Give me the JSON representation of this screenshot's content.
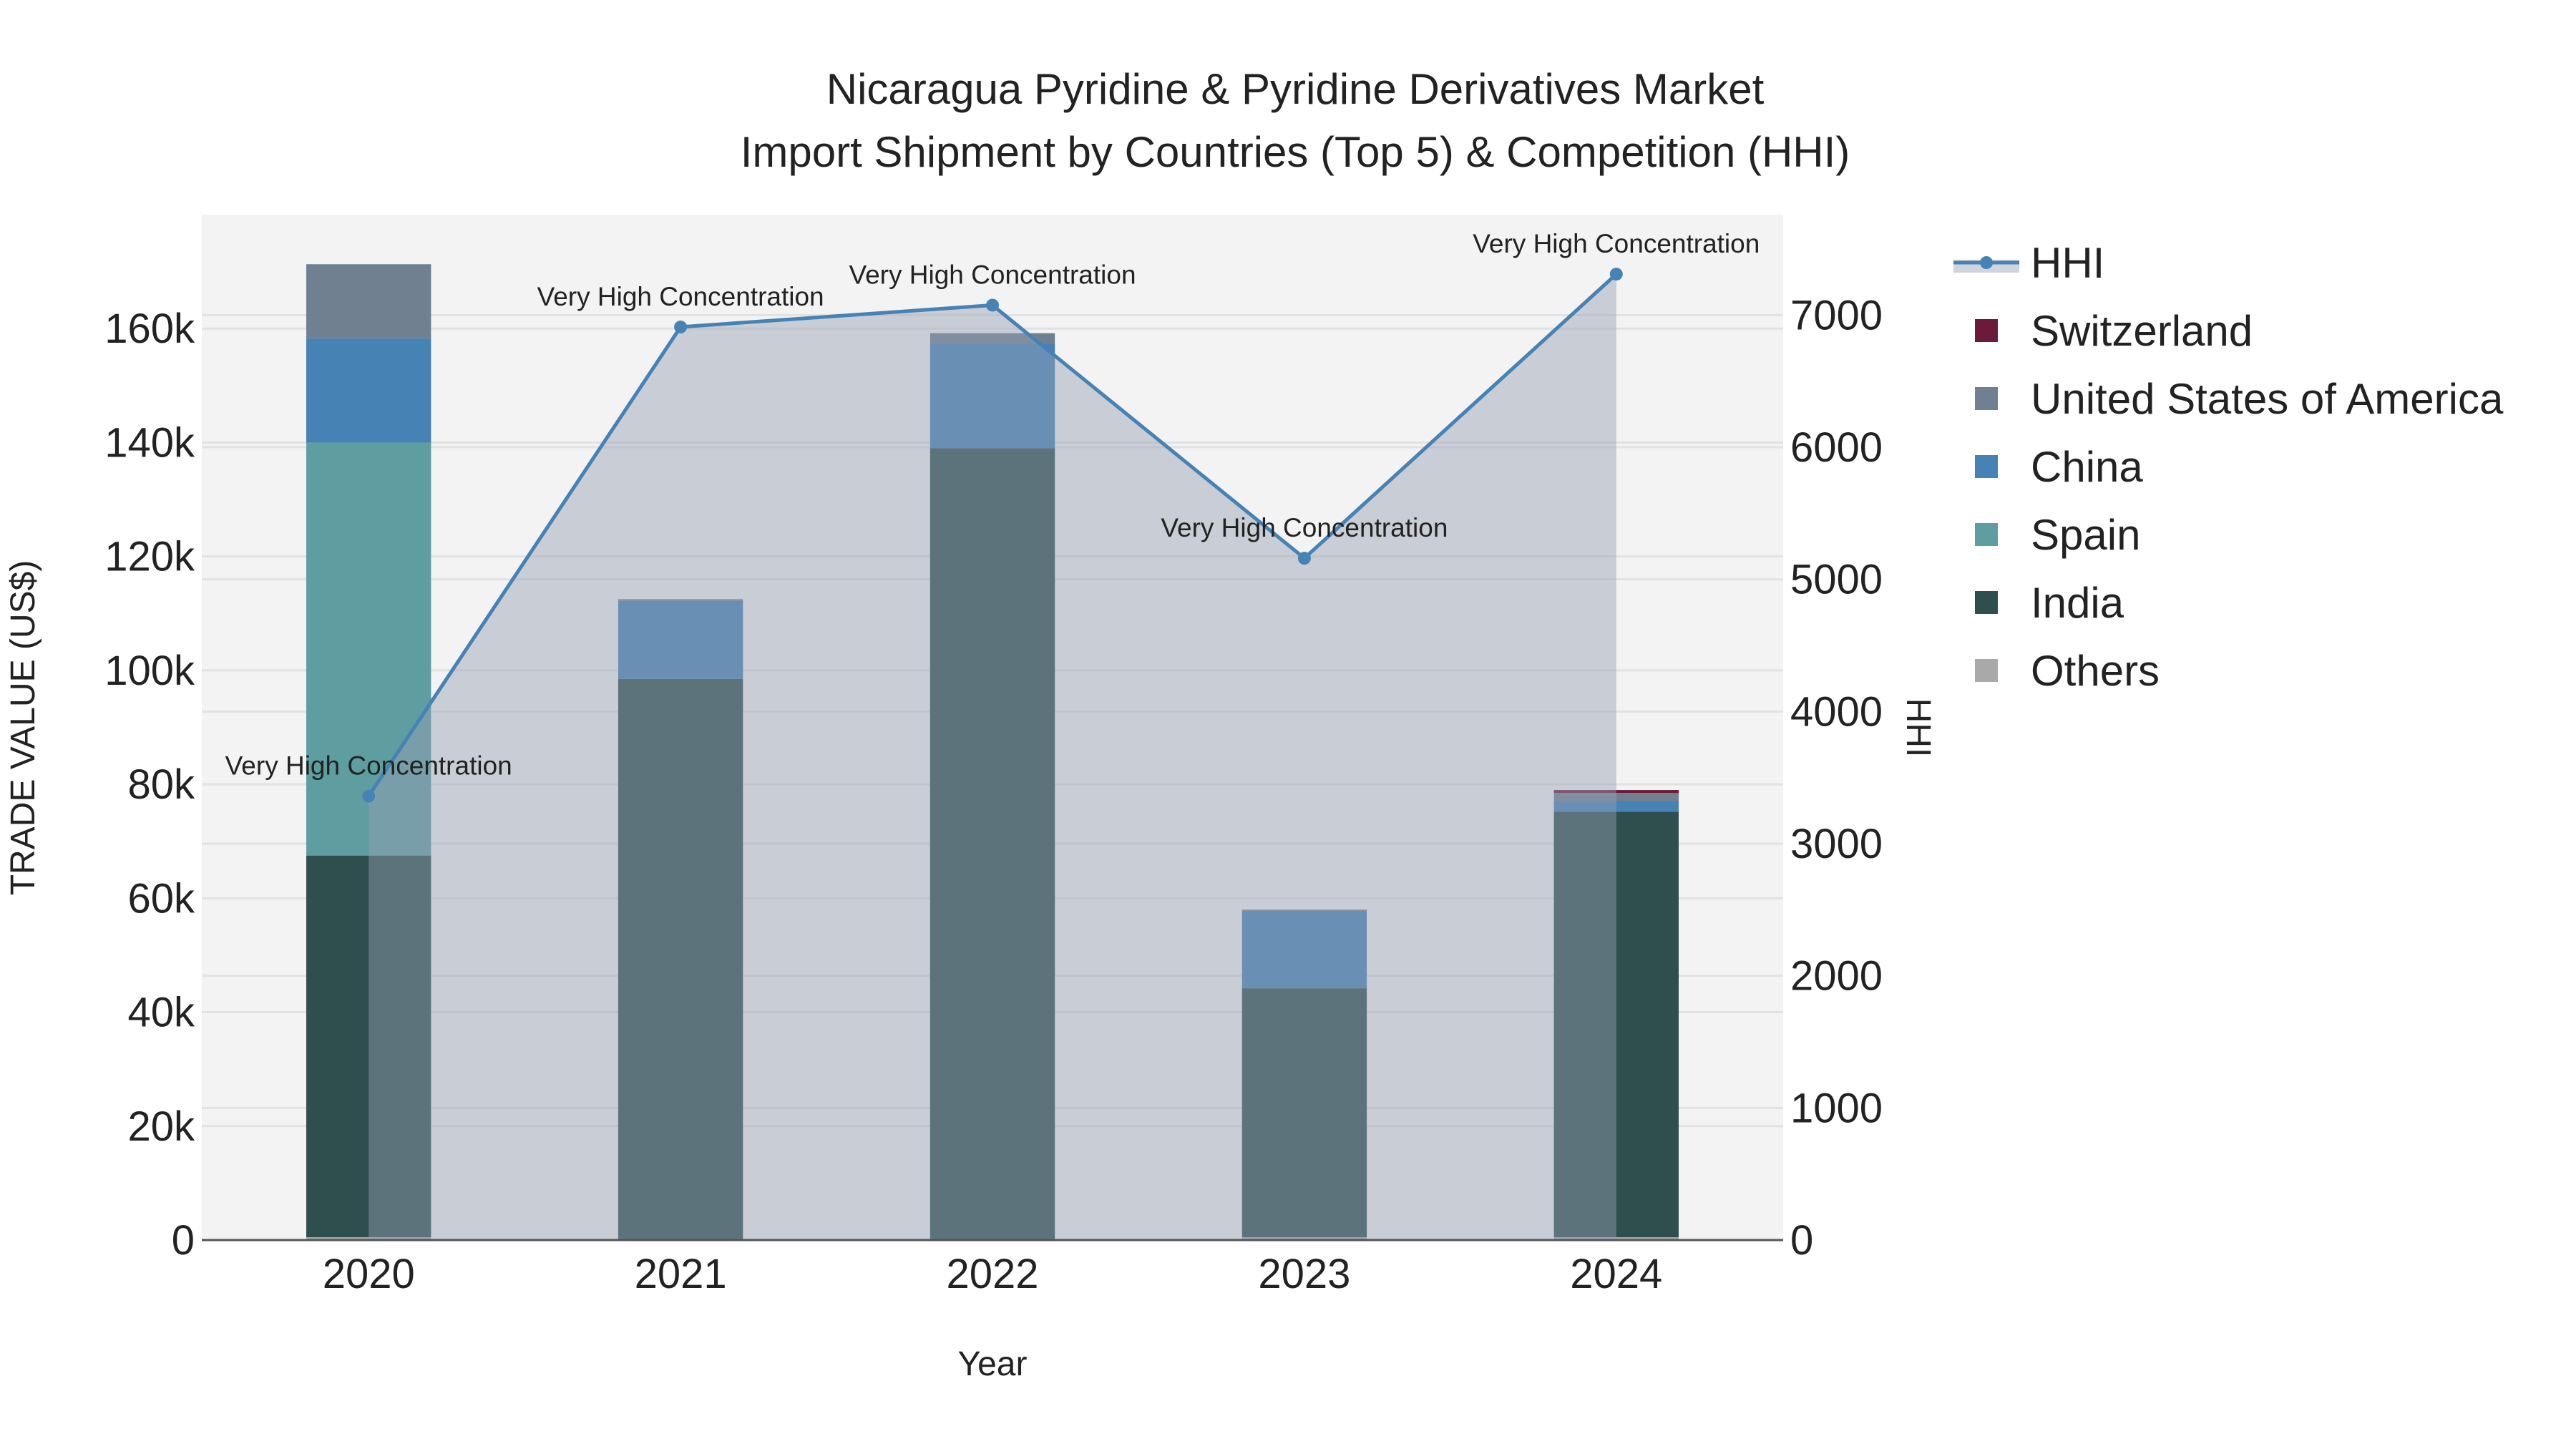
{
  "chart_data": {
    "type": "bar",
    "title_line1": "Nicaragua Pyridine & Pyridine Derivatives Market",
    "title_line2": "Import Shipment by Countries (Top 5) & Competition (HHI)",
    "xlabel": "Year",
    "ylabel": "TRADE VALUE (US$)",
    "y2label": "HHI",
    "categories": [
      "2020",
      "2021",
      "2022",
      "2023",
      "2024"
    ],
    "ylim": [
      0,
      180000
    ],
    "y_ticks": [
      0,
      20000,
      40000,
      60000,
      80000,
      100000,
      120000,
      140000,
      160000
    ],
    "y_tick_labels": [
      "0",
      "20k",
      "40k",
      "60k",
      "80k",
      "100k",
      "120k",
      "140k",
      "160k"
    ],
    "y2lim": [
      0,
      7760
    ],
    "y2_ticks": [
      0,
      1000,
      2000,
      3000,
      4000,
      5000,
      6000,
      7000
    ],
    "y2_tick_labels": [
      "0",
      "1000",
      "2000",
      "3000",
      "4000",
      "5000",
      "6000",
      "7000"
    ],
    "grid": true,
    "legend_placement": "right",
    "series": [
      {
        "name": "Others",
        "color": "#A9A9A9",
        "values": [
          500,
          0,
          0,
          500,
          500
        ]
      },
      {
        "name": "India",
        "color": "#2F4F4F",
        "values": [
          67000,
          98500,
          139000,
          43700,
          74700
        ]
      },
      {
        "name": "Spain",
        "color": "#5F9EA0",
        "values": [
          72500,
          0,
          0,
          0,
          0
        ]
      },
      {
        "name": "China",
        "color": "#4682B4",
        "values": [
          18300,
          13700,
          18500,
          13600,
          1800
        ]
      },
      {
        "name": "United States of America",
        "color": "#708090",
        "values": [
          13000,
          300,
          1700,
          200,
          1500
        ]
      },
      {
        "name": "Switzerland",
        "color": "#6B1A3A",
        "values": [
          0,
          0,
          0,
          0,
          500
        ]
      }
    ],
    "hhi": {
      "name": "HHI",
      "color": "#4682B4",
      "values": [
        3360,
        6910,
        7075,
        5160,
        7310
      ],
      "annotations": [
        "Very High Concentration",
        "Very High Concentration",
        "Very High Concentration",
        "Very High Concentration",
        "Very High Concentration"
      ]
    },
    "legend": [
      "HHI",
      "Switzerland",
      "United States of America",
      "China",
      "Spain",
      "India",
      "Others"
    ]
  }
}
